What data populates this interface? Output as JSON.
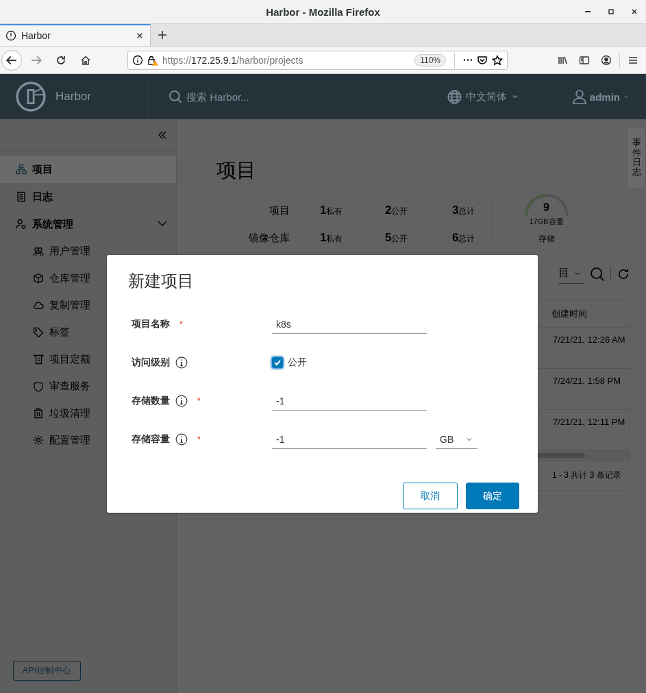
{
  "browser": {
    "window_title": "Harbor - Mozilla Firefox",
    "tabs": [
      {
        "title": "Harbor",
        "selected": true
      }
    ],
    "url": {
      "scheme": "https://",
      "host": "172.25.9.1",
      "path": "/harbor/projects"
    },
    "zoom": "110%"
  },
  "header": {
    "brand": "Harbor",
    "search": {
      "placeholder": "搜索 Harbor..."
    },
    "language": "中文简体",
    "user": "admin"
  },
  "sidebar": {
    "items": [
      {
        "label": "项目",
        "selected": true
      },
      {
        "label": "日志",
        "selected": false
      },
      {
        "label": "系统管理",
        "selected": false,
        "expanded": true,
        "children": [
          {
            "label": "用户管理"
          },
          {
            "label": "仓库管理"
          },
          {
            "label": "复制管理"
          },
          {
            "label": "标签"
          },
          {
            "label": "项目定额"
          },
          {
            "label": "审查服务"
          },
          {
            "label": "垃圾清理"
          },
          {
            "label": "配置管理"
          }
        ]
      }
    ],
    "api_button": "API控制中心"
  },
  "page": {
    "title": "项目",
    "stats": [
      {
        "label": "项目",
        "values": [
          {
            "count": "1",
            "unit": "私有"
          },
          {
            "count": "2",
            "unit": "公开"
          },
          {
            "count": "3",
            "unit": "总计"
          }
        ]
      },
      {
        "label": "镜像仓库",
        "values": [
          {
            "count": "1",
            "unit": "私有"
          },
          {
            "count": "5",
            "unit": "公开"
          },
          {
            "count": "6",
            "unit": "总计"
          }
        ]
      }
    ],
    "storage": {
      "value": "9",
      "capacity": "17GB容量",
      "label": "存储",
      "level": 0.5
    },
    "event_log_tab": "事件日志",
    "filter": "目",
    "table": {
      "columns": [
        "创建时间"
      ],
      "rows": [
        [
          "7/21/21, 12:26 AM"
        ],
        [
          "7/24/21, 1:58 PM"
        ],
        [
          "7/21/21, 12:11 PM"
        ]
      ]
    },
    "pagination": "1 - 3 共计 3 条记录"
  },
  "dialog": {
    "title": "新建项目",
    "fields": [
      {
        "kind": "text",
        "label": "项目名称",
        "info": false,
        "required_mark": "*",
        "value": "k8s"
      },
      {
        "kind": "checkbox",
        "label": "访问级别",
        "info": true,
        "checked": true,
        "option": "公开"
      },
      {
        "kind": "text",
        "label": "存储数量",
        "info": true,
        "required_mark": "*",
        "value": "-1"
      },
      {
        "kind": "text-unit",
        "label": "存储容量",
        "info": true,
        "required_mark": "*",
        "value": "-1",
        "unit": "GB"
      }
    ],
    "buttons": [
      {
        "label": "取消",
        "kind": "secondary"
      },
      {
        "label": "确定",
        "kind": "primary"
      }
    ]
  }
}
